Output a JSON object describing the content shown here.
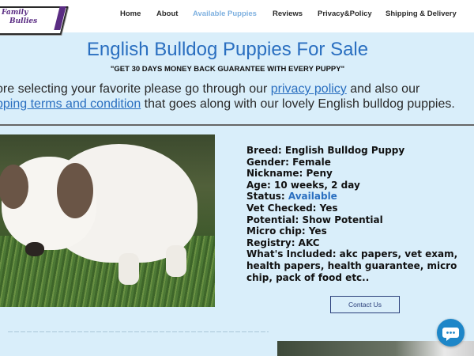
{
  "brand": {
    "logo_line1": "Family",
    "logo_line2": "Bullies"
  },
  "nav": {
    "items": [
      {
        "label": "Home"
      },
      {
        "label": "About"
      },
      {
        "label": "Available Puppies",
        "active": true
      },
      {
        "label": "Reviews"
      },
      {
        "label": "Privacy&Policy"
      },
      {
        "label": "Shipping & Delivery"
      }
    ]
  },
  "hero": {
    "title": "English Bulldog Puppies For Sale",
    "subtitle": "\"GET 30 DAYS MONEY BACK GUARANTEE WITH EVERY PUPPY\"",
    "intro_part1": "ore selecting your favorite please go through our ",
    "intro_link1": "privacy policy",
    "intro_part2": " and also our",
    "intro_link2": "pping terms and condition",
    "intro_part3": " that goes along with our lovely English bulldog puppies."
  },
  "puppy": {
    "breed": "Breed: English Bulldog Puppy",
    "gender": "Gender: Female",
    "nickname": "Nickname: Peny",
    "age": "Age: 10 weeks, 2 day",
    "status_label": "Status: ",
    "status_value": "Available",
    "vet_checked": "Vet Checked: Yes",
    "potential": "Potential: Show Potential",
    "micro_chip": "Micro chip: Yes",
    "registry": "Registry: AKC",
    "included": "What's Included: akc papers, vet exam, health papers, health guarantee, micro chip, pack of food etc.."
  },
  "contact_button": "Contact Us",
  "icons": {
    "chat": "chat-bubble-icon"
  },
  "colors": {
    "page_bg": "#d9eefa",
    "accent": "#2a6fc0",
    "nav_active": "#7fb1e0",
    "logo_purple": "#5a2c83",
    "chat_button": "#1d86c8"
  }
}
